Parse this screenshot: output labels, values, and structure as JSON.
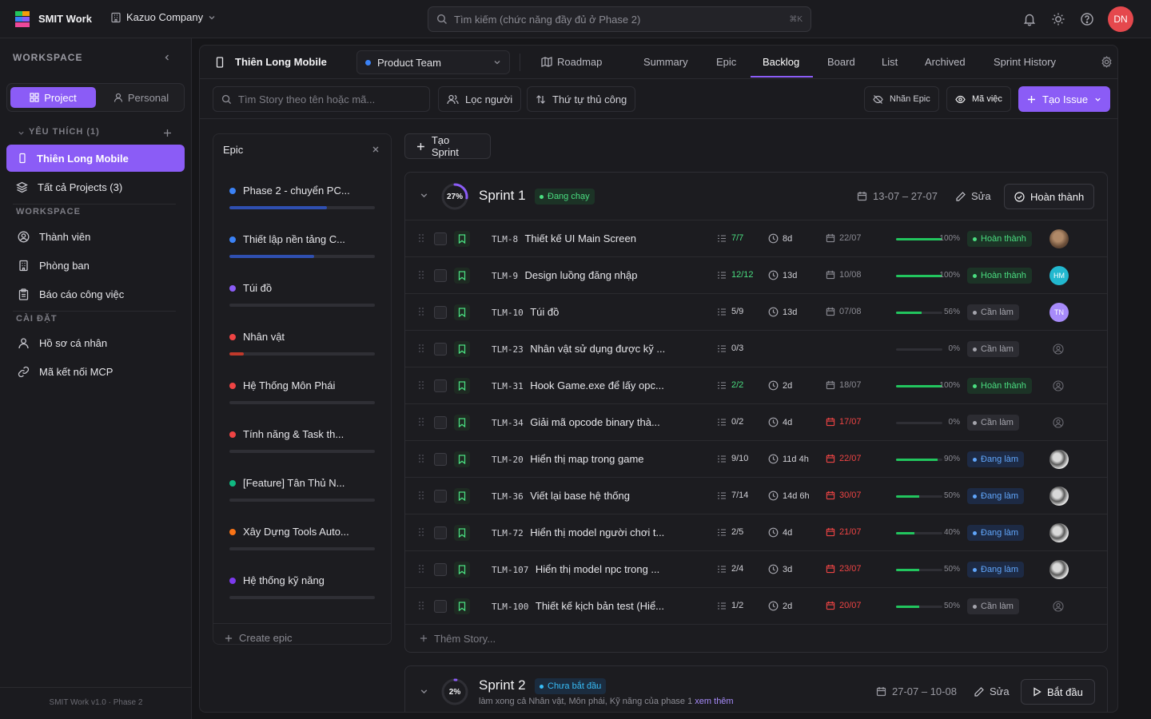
{
  "app": {
    "name": "SMIT Work",
    "company": "Kazuo Company"
  },
  "search": {
    "placeholder": "Tìm kiếm (chức năng đầy đủ ở Phase 2)",
    "shortcut": "⌘K"
  },
  "user": {
    "initials": "DN"
  },
  "sidebar": {
    "workspace_title": "WORKSPACE",
    "segment": {
      "project": "Project",
      "personal": "Personal"
    },
    "favorites_label": "YÊU THÍCH (1)",
    "favorite_project": "Thiên Long Mobile",
    "all_projects": "Tất cả Projects (3)",
    "workspace_section": "WORKSPACE",
    "workspace_items": [
      "Thành viên",
      "Phòng ban",
      "Báo cáo công việc"
    ],
    "settings_section": "CÀI ĐẶT",
    "settings_items": [
      "Hồ sơ cá nhân",
      "Mã kết nối MCP"
    ],
    "version": "SMIT Work v1.0 · Phase 2"
  },
  "project": {
    "name": "Thiên Long Mobile",
    "team": "Product Team",
    "tabs": [
      "Roadmap",
      "Summary",
      "Epic",
      "Backlog",
      "Board",
      "List",
      "Archived",
      "Sprint History"
    ],
    "active_tab": "Backlog"
  },
  "toolbar": {
    "story_search_placeholder": "Tìm Story theo tên hoặc mã...",
    "filter_people": "Lọc người",
    "manual_order": "Thứ tự thủ công",
    "hide_epic": "Nhãn Epic",
    "issue_key": "Mã việc",
    "create_issue": "Tạo Issue"
  },
  "epic_panel": {
    "title": "Epic",
    "create_label": "Create epic",
    "items": [
      {
        "name": "Phase 2 - chuyển PC...",
        "color": "#3b82f6",
        "progress": 0.67,
        "bar_color": "#2f4fb0"
      },
      {
        "name": "Thiết lập nền tảng C...",
        "color": "#3b82f6",
        "progress": 0.58,
        "bar_color": "#2f4fb0"
      },
      {
        "name": "Túi đồ",
        "color": "#8b5cf6",
        "progress": 0,
        "bar_color": "#8b5cf6"
      },
      {
        "name": "Nhân vật",
        "color": "#ef4444",
        "progress": 0.1,
        "bar_color": "#c0392b"
      },
      {
        "name": "Hệ Thống Môn Phái",
        "color": "#ef4444",
        "progress": 0,
        "bar_color": "#ef4444"
      },
      {
        "name": "Tính năng & Task th...",
        "color": "#ef4444",
        "progress": 0,
        "bar_color": "#ef4444"
      },
      {
        "name": "[Feature] Tân Thủ N...",
        "color": "#10b981",
        "progress": 0,
        "bar_color": "#10b981"
      },
      {
        "name": "Xây Dựng Tools Auto...",
        "color": "#f97316",
        "progress": 0,
        "bar_color": "#f97316"
      },
      {
        "name": "Hệ thống kỹ năng",
        "color": "#7c3aed",
        "progress": 0,
        "bar_color": "#7c3aed"
      }
    ]
  },
  "create_sprint": "Tạo Sprint",
  "sprints": [
    {
      "name": "Sprint 1",
      "percent": "27%",
      "progress": 0.27,
      "status": "Đang chạy",
      "dates": "13-07 – 27-07",
      "edit": "Sửa",
      "action": "Hoàn thành",
      "add_story": "Thêm Story...",
      "issues": [
        {
          "key": "TLM-8",
          "title": "Thiết kế UI Main Screen",
          "subtasks": "7/7",
          "sub_done": true,
          "estimate": "8d",
          "due": "22/07",
          "overdue": false,
          "progress": 1.0,
          "pct": "100%",
          "status": "Hoàn thành",
          "status_type": "done",
          "assignee": "photo"
        },
        {
          "key": "TLM-9",
          "title": "Design luồng đăng nhập",
          "subtasks": "12/12",
          "sub_done": true,
          "estimate": "13d",
          "due": "10/08",
          "overdue": false,
          "progress": 1.0,
          "pct": "100%",
          "status": "Hoàn thành",
          "status_type": "done",
          "assignee": "HM"
        },
        {
          "key": "TLM-10",
          "title": "Túi đồ",
          "subtasks": "5/9",
          "sub_done": false,
          "estimate": "13d",
          "due": "07/08",
          "overdue": false,
          "progress": 0.56,
          "pct": "56%",
          "status": "Cần làm",
          "status_type": "todo",
          "assignee": "TN"
        },
        {
          "key": "TLM-23",
          "title": "Nhân vật sử dụng được kỹ ...",
          "subtasks": "0/3",
          "sub_done": false,
          "estimate": "",
          "due": "",
          "overdue": false,
          "progress": 0,
          "pct": "0%",
          "status": "Cần làm",
          "status_type": "todo",
          "assignee": ""
        },
        {
          "key": "TLM-31",
          "title": "Hook Game.exe để lấy opc...",
          "subtasks": "2/2",
          "sub_done": true,
          "estimate": "2d",
          "due": "18/07",
          "overdue": false,
          "progress": 1.0,
          "pct": "100%",
          "status": "Hoàn thành",
          "status_type": "done",
          "assignee": ""
        },
        {
          "key": "TLM-34",
          "title": "Giải mã opcode binary thà...",
          "subtasks": "0/2",
          "sub_done": false,
          "estimate": "4d",
          "due": "17/07",
          "overdue": true,
          "progress": 0,
          "pct": "0%",
          "status": "Cần làm",
          "status_type": "todo",
          "assignee": ""
        },
        {
          "key": "TLM-20",
          "title": "Hiển thị map trong game",
          "subtasks": "9/10",
          "sub_done": false,
          "estimate": "11d 4h",
          "due": "22/07",
          "overdue": true,
          "progress": 0.9,
          "pct": "90%",
          "status": "Đang làm",
          "status_type": "prog",
          "assignee": "photo"
        },
        {
          "key": "TLM-36",
          "title": "Viết lại base hệ thống",
          "subtasks": "7/14",
          "sub_done": false,
          "estimate": "14d 6h",
          "due": "30/07",
          "overdue": true,
          "progress": 0.5,
          "pct": "50%",
          "status": "Đang làm",
          "status_type": "prog",
          "assignee": "photo"
        },
        {
          "key": "TLM-72",
          "title": "Hiển thị model người chơi t...",
          "subtasks": "2/5",
          "sub_done": false,
          "estimate": "4d",
          "due": "21/07",
          "overdue": true,
          "progress": 0.4,
          "pct": "40%",
          "status": "Đang làm",
          "status_type": "prog",
          "assignee": "photo"
        },
        {
          "key": "TLM-107",
          "title": "Hiển thị model npc trong ...",
          "subtasks": "2/4",
          "sub_done": false,
          "estimate": "3d",
          "due": "23/07",
          "overdue": true,
          "progress": 0.5,
          "pct": "50%",
          "status": "Đang làm",
          "status_type": "prog",
          "assignee": "photo"
        },
        {
          "key": "TLM-100",
          "title": "Thiết kế kịch bản test (Hiể...",
          "subtasks": "1/2",
          "sub_done": false,
          "estimate": "2d",
          "due": "20/07",
          "overdue": true,
          "progress": 0.5,
          "pct": "50%",
          "status": "Cần làm",
          "status_type": "todo",
          "assignee": ""
        }
      ]
    },
    {
      "name": "Sprint 2",
      "percent": "2%",
      "progress": 0.02,
      "status": "Chưa bắt đầu",
      "dates": "27-07 – 10-08",
      "edit": "Sửa",
      "action": "Bắt đầu",
      "description": "làm xong cả Nhân vật, Môn phái, Kỹ năng của phase 1",
      "see_more": "xem thêm"
    }
  ]
}
